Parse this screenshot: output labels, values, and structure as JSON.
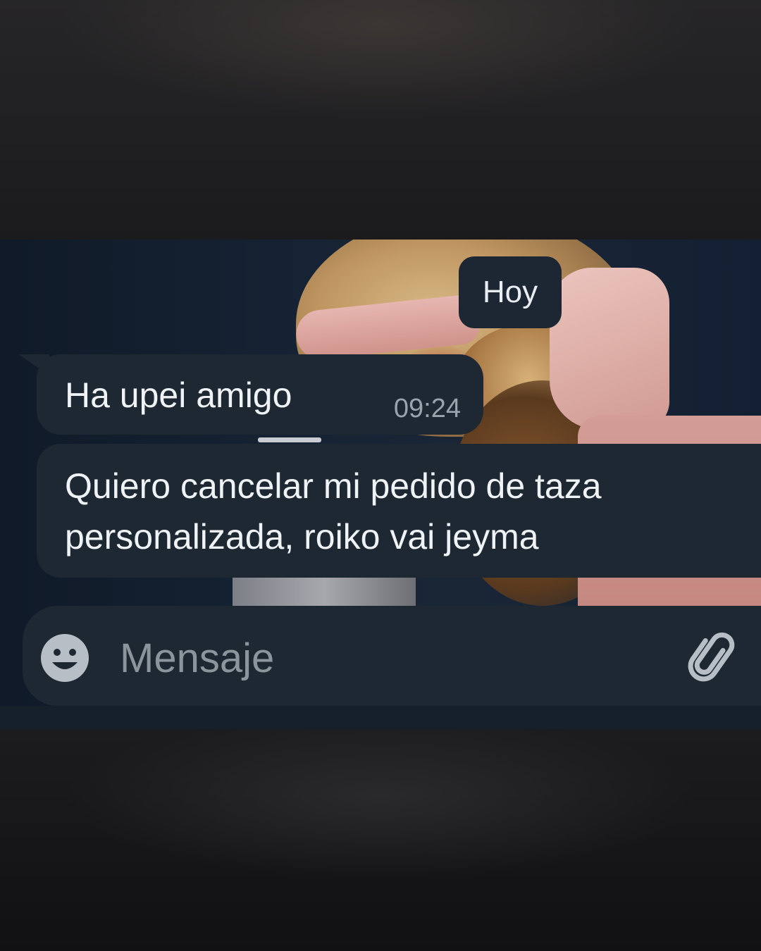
{
  "date_separator": "Hoy",
  "messages": [
    {
      "text": "Ha upei amigo",
      "time": "09:24"
    },
    {
      "text": "Quiero cancelar mi pedido de taza personalizada, roiko vai jeyma"
    }
  ],
  "composer": {
    "placeholder": "Mensaje",
    "emoji_icon": "smiley-icon",
    "attach_icon": "paperclip-icon"
  },
  "colors": {
    "bubble": "#1d2833",
    "text": "#f0f3f5",
    "muted": "#9aa4ad",
    "wallpaper": "#152233"
  }
}
